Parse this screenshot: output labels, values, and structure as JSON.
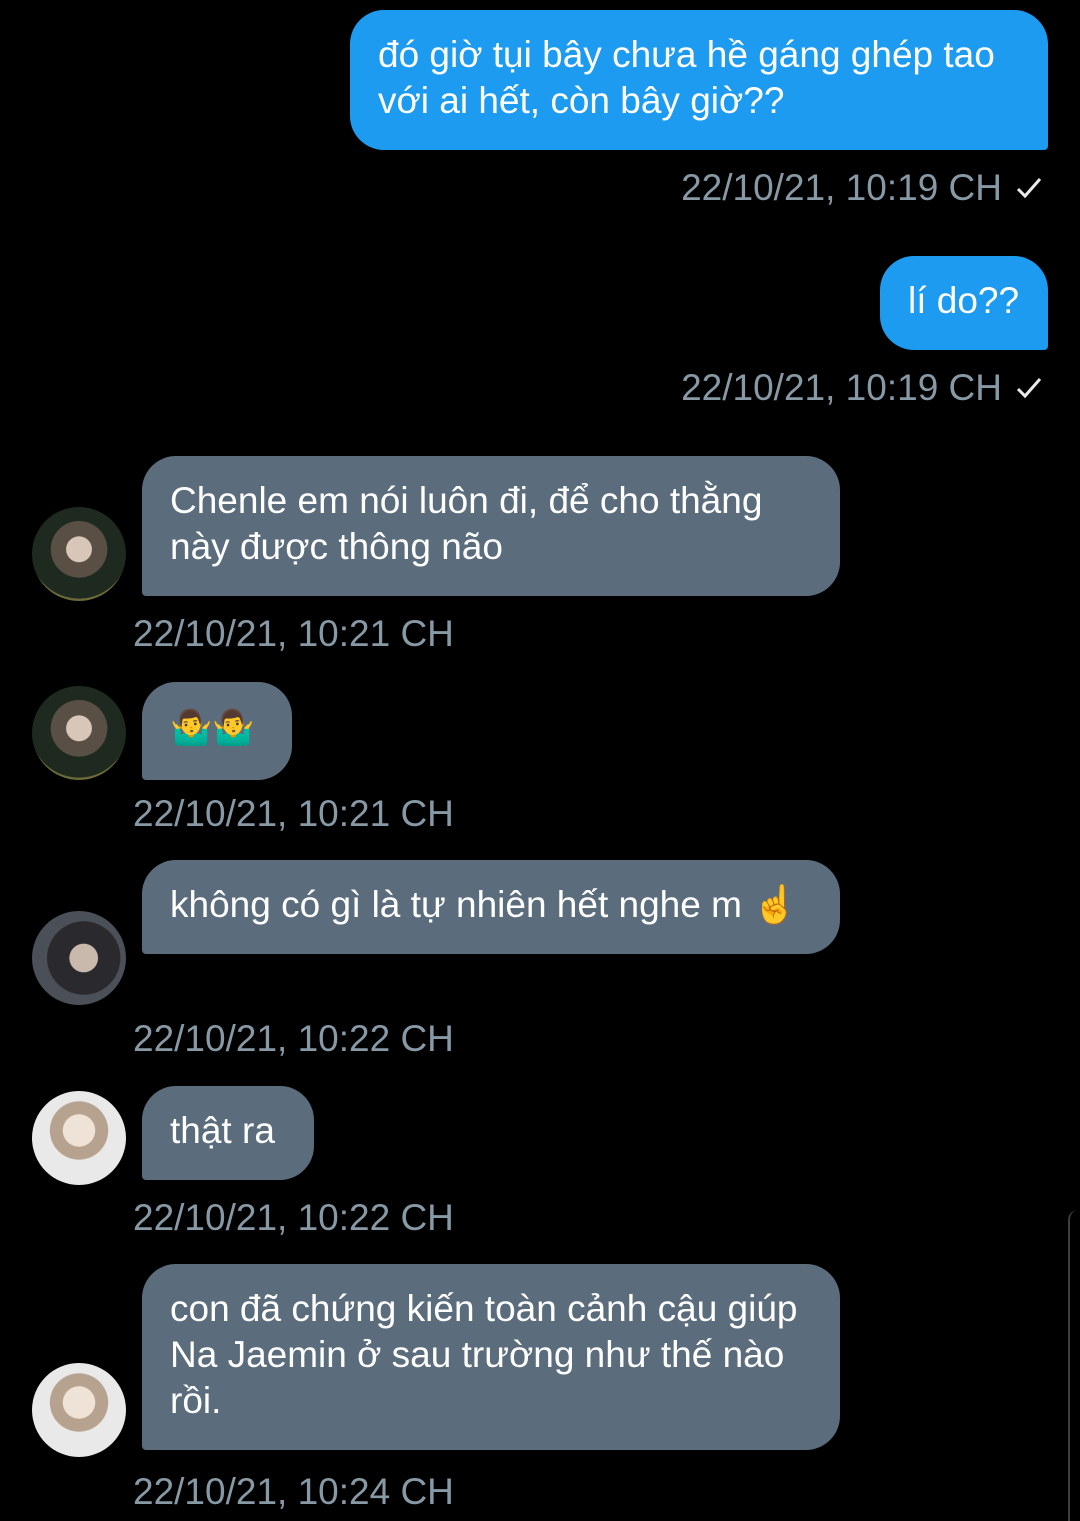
{
  "messages": [
    {
      "text": "đó giờ tụi bây chưa hề gáng ghép tao với ai hết, còn bây giờ??",
      "time": "22/10/21, 10:19 CH"
    },
    {
      "text": "lí do??",
      "time": "22/10/21, 10:19 CH"
    },
    {
      "text": "Chenle em nói luôn đi, để cho thằng này được thông não",
      "time": "22/10/21, 10:21 CH"
    },
    {
      "text": "🤷‍♂️🤷‍♂️",
      "time": "22/10/21, 10:21 CH"
    },
    {
      "text": "không có gì là tự nhiên hết nghe m ☝️",
      "time": "22/10/21, 10:22 CH"
    },
    {
      "text": "thật ra",
      "time": "22/10/21, 10:22 CH"
    },
    {
      "text": "con đã chứng kiến toàn cảnh cậu giúp Na Jaemin ở sau trường như thế nào rồi.",
      "time": "22/10/21, 10:24 CH"
    }
  ],
  "colors": {
    "outgoing_bubble": "#1d9bf0",
    "incoming_bubble": "#5b6d7c",
    "timestamp": "#8899a6",
    "background": "#000000"
  },
  "icons": {
    "sent": "checkmark-icon",
    "avatar": "user-avatar"
  }
}
